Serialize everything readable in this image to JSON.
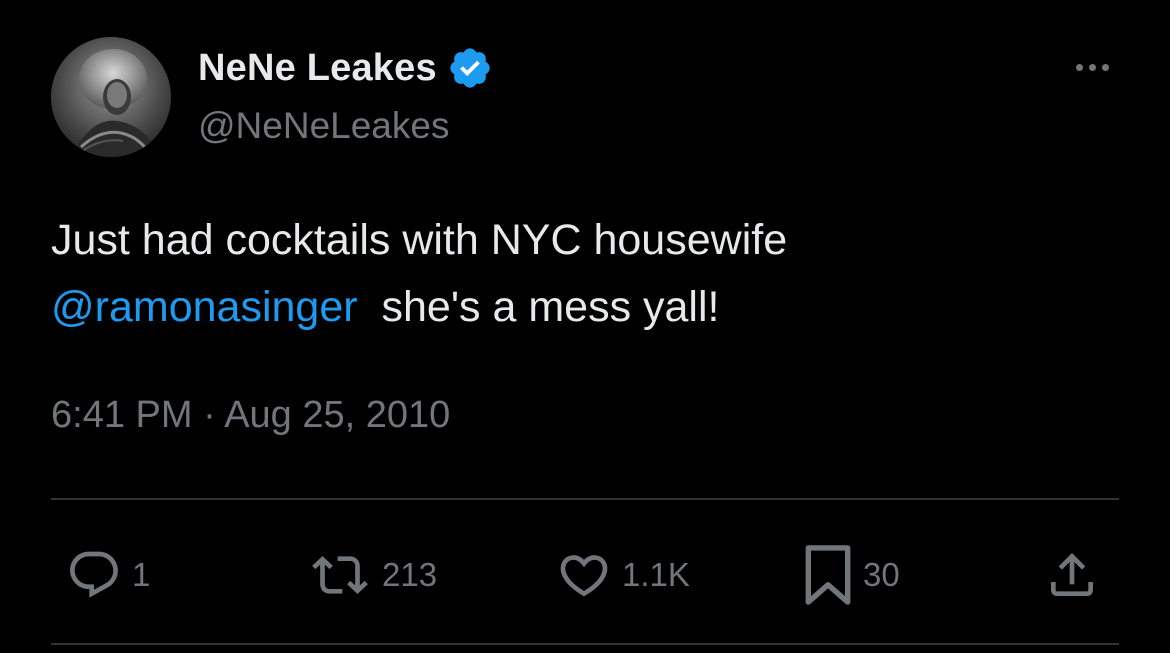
{
  "author": {
    "display_name": "NeNe Leakes",
    "handle": "@NeNeLeakes",
    "verified": true,
    "verified_color": "#1d9bf0"
  },
  "tweet": {
    "line1": "Just had cocktails with NYC housewife",
    "mention": "@ramonasinger",
    "line2_rest": "she's a mess yall!",
    "timestamp": "6:41 PM · Aug 25, 2010"
  },
  "actions": {
    "reply": {
      "icon": "reply-icon",
      "count": "1"
    },
    "retweet": {
      "icon": "retweet-icon",
      "count": "213"
    },
    "like": {
      "icon": "heart-icon",
      "count": "1.1K"
    },
    "bookmark": {
      "icon": "bookmark-icon",
      "count": "30"
    },
    "share": {
      "icon": "share-icon"
    }
  },
  "colors": {
    "background": "#000000",
    "text": "#e7e9ea",
    "secondary": "#71767b",
    "link": "#1d9bf0",
    "divider": "#2f3336"
  }
}
